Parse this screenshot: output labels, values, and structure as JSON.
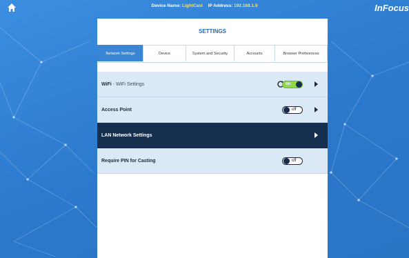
{
  "topbar": {
    "device_name_label": "Device Name:",
    "device_name_value": "LightCast",
    "ip_label": "IP Address:",
    "ip_value": "192.168.1.9",
    "brand": "InFocus"
  },
  "settings": {
    "title": "SETTINGS",
    "tabs": [
      {
        "label": "Network Settings",
        "active": true
      },
      {
        "label": "Device"
      },
      {
        "label": "System and Security"
      },
      {
        "label": "Accounts"
      },
      {
        "label": "Browser Preferences"
      }
    ],
    "rows": [
      {
        "label": "WiFi",
        "sub": " - WiFi Settings",
        "toggle": "on",
        "toggle_text": "on",
        "has_refresh": true
      },
      {
        "label": "Access Point",
        "toggle": "off",
        "toggle_text": "off"
      },
      {
        "label": "LAN Network Settings"
      },
      {
        "label": "Require PIN for Casting",
        "toggle": "off",
        "toggle_text": "off"
      }
    ]
  },
  "colors": {
    "background": "#2f7dd0",
    "active_tab": "#3a86d4",
    "row_bg": "#dbe9f6",
    "row_dark": "#152e4d",
    "toggle_on": "#8fd84a"
  },
  "icons": [
    "home-icon",
    "refresh-icon",
    "chevron-right-icon"
  ]
}
